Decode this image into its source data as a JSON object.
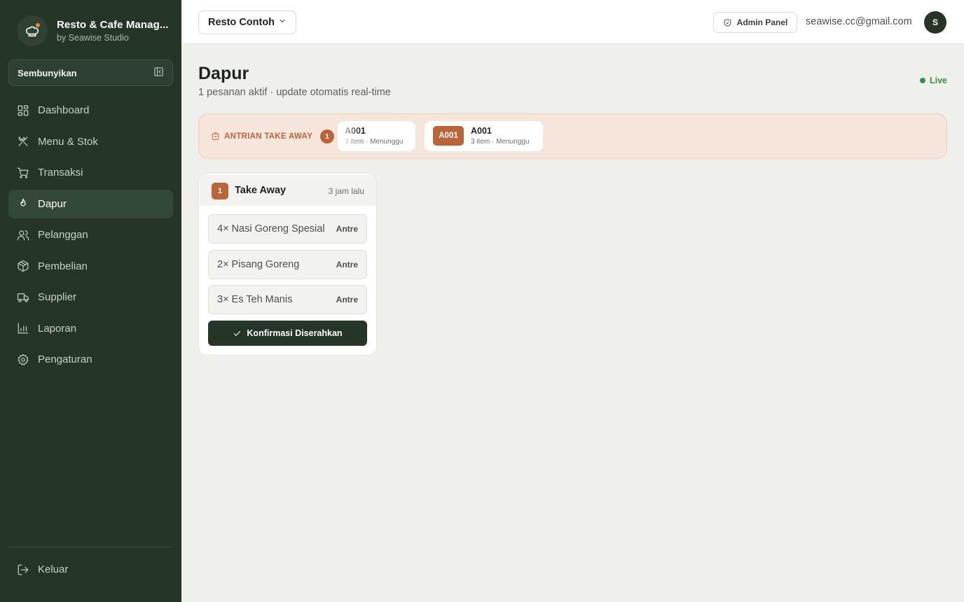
{
  "brand": {
    "title": "Resto & Cafe Manag...",
    "subtitle": "by Seawise Studio"
  },
  "sidebar": {
    "collapse_label": "Sembunyikan",
    "items": [
      {
        "label": "Dashboard",
        "icon": "dashboard-icon"
      },
      {
        "label": "Menu & Stok",
        "icon": "utensils-icon"
      },
      {
        "label": "Transaksi",
        "icon": "cart-icon"
      },
      {
        "label": "Dapur",
        "icon": "flame-icon",
        "active": true
      },
      {
        "label": "Pelanggan",
        "icon": "users-icon"
      },
      {
        "label": "Pembelian",
        "icon": "package-icon"
      },
      {
        "label": "Supplier",
        "icon": "truck-icon"
      },
      {
        "label": "Laporan",
        "icon": "bar-chart-icon"
      },
      {
        "label": "Pengaturan",
        "icon": "gear-icon"
      }
    ],
    "logout_label": "Keluar"
  },
  "topbar": {
    "resto_name": "Resto Contoh",
    "admin_label": "Admin Panel",
    "email": "seawise.cc@gmail.com",
    "avatar_initial": "S"
  },
  "page": {
    "title": "Dapur",
    "subtitle": "1 pesanan aktif · update otomatis real-time",
    "live_label": "Live"
  },
  "queue": {
    "label": "ANTRIAN TAKE AWAY",
    "count": "1",
    "tickets": [
      {
        "code": "A001",
        "meta": "3 item · Menunggu"
      },
      {
        "badge": "A001",
        "code": "A001",
        "meta": "3 item · Menunggu"
      }
    ]
  },
  "order": {
    "number": "1",
    "type": "Take Away",
    "time": "3 jam lalu",
    "items": [
      {
        "name": "4× Nasi Goreng Spesial",
        "status": "Antre"
      },
      {
        "name": "2× Pisang Goreng",
        "status": "Antre"
      },
      {
        "name": "3× Es Teh Manis",
        "status": "Antre"
      }
    ],
    "confirm_label": "Konfirmasi Diserahkan"
  },
  "colors": {
    "sidebar_bg": "#253528",
    "accent": "#b9653b",
    "live": "#3c8a4d",
    "queue_bg": "#f6e5da"
  }
}
